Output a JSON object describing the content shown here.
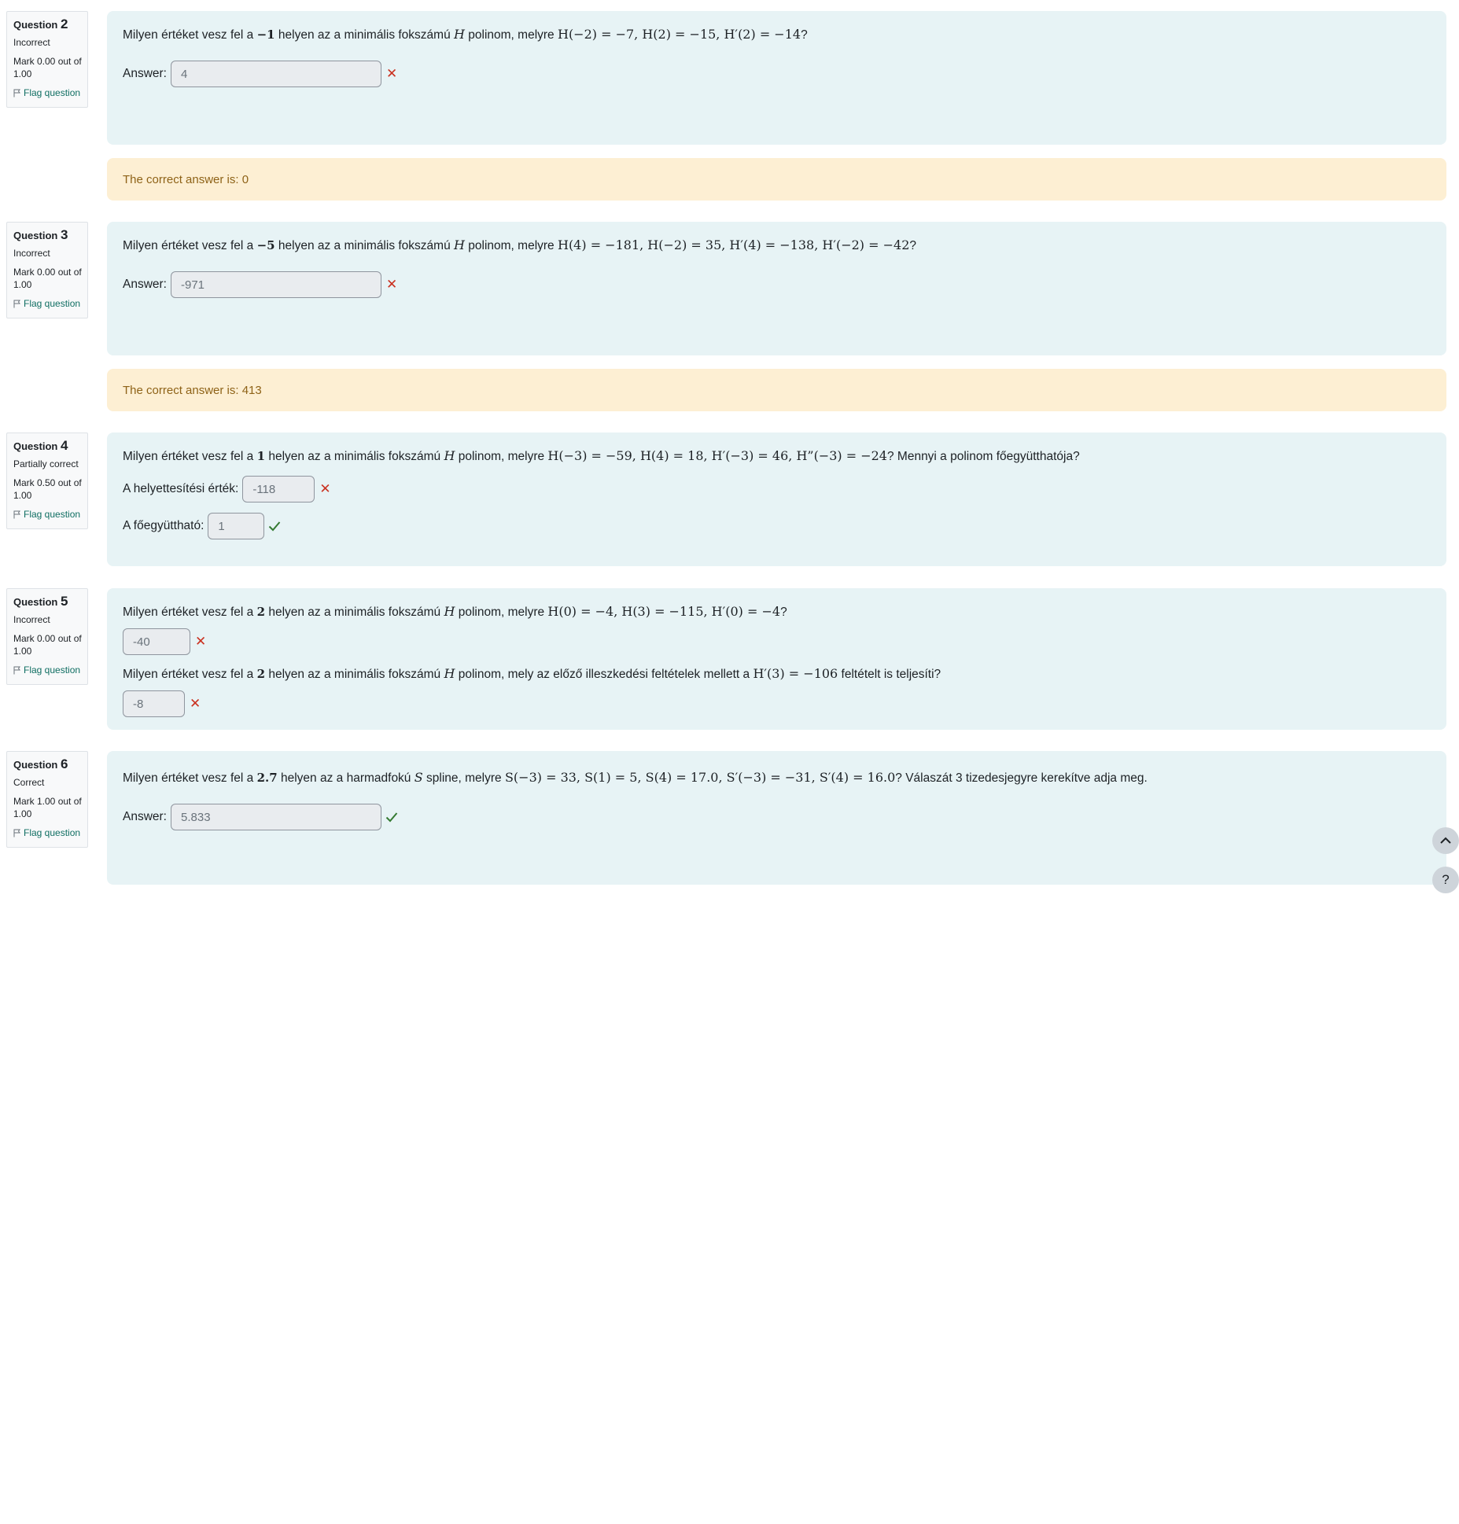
{
  "flag_label": "Flag question",
  "questions": [
    {
      "heading": "Question",
      "number": "2",
      "state": "Incorrect",
      "mark": "Mark 0.00 out of 1.00",
      "text_a": "Milyen értéket vesz fel a ",
      "math_point": "−1",
      "text_b": " helyen az a minimális fokszámú ",
      "math_var": "H",
      "text_c": " polinom, melyre ",
      "conditions": "H(−2) = −7,  H(2) = −15,  H′(2) = −14",
      "text_d": "?",
      "answer_label": "Answer:",
      "answer_value": "4",
      "correct_answer_text": "The correct answer is: 0"
    },
    {
      "heading": "Question",
      "number": "3",
      "state": "Incorrect",
      "mark": "Mark 0.00 out of 1.00",
      "text_a": "Milyen értéket vesz fel a ",
      "math_point": "−5",
      "text_b": " helyen az a minimális fokszámú ",
      "math_var": "H",
      "text_c": " polinom, melyre ",
      "conditions": "H(4) = −181,  H(−2) = 35,  H′(4) = −138, H′(−2) = −42",
      "text_d": "?",
      "answer_label": "Answer:",
      "answer_value": "-971",
      "correct_answer_text": "The correct answer is: 413"
    },
    {
      "heading": "Question",
      "number": "4",
      "state": "Partially correct",
      "mark": "Mark 0.50 out of 1.00",
      "text_a": "Milyen értéket vesz fel a ",
      "math_point": "1",
      "text_b": " helyen az a minimális fokszámú ",
      "math_var": "H",
      "text_c": " polinom, melyre ",
      "conditions": "H(−3) = −59,  H(4) = 18,  H′(−3) = 46, H”(−3) = −24",
      "text_d": "? Mennyi a polinom főegyütthatója?",
      "sub1_label": "A helyettesítési érték:",
      "sub1_value": "-118",
      "sub2_label": "A főegyüttható:",
      "sub2_value": "1"
    },
    {
      "heading": "Question",
      "number": "5",
      "state": "Incorrect",
      "mark": "Mark 0.00 out of 1.00",
      "text_a": "Milyen értéket vesz fel a ",
      "math_point": "2",
      "text_b": " helyen az a minimális fokszámú ",
      "math_var": "H",
      "text_c": " polinom, melyre ",
      "conditions": "H(0) = −4,  H(3) = −115,  H′(0) = −4",
      "text_d": "?",
      "answer1_value": "-40",
      "text2_a": "Milyen értéket vesz fel a ",
      "math2_point": "2",
      "text2_b": " helyen az a minimális fokszámú ",
      "math2_var": "H",
      "text2_c": " polinom, mely az előző illeszkedési feltételek mellett a ",
      "conditions2": "H′(3) = −106",
      "text2_d": " feltételt is teljesíti?",
      "answer2_value": "-8"
    },
    {
      "heading": "Question",
      "number": "6",
      "state": "Correct",
      "mark": "Mark 1.00 out of 1.00",
      "text_a": "Milyen értéket vesz fel a ",
      "math_point": "2.7",
      "text_b": " helyen az a harmadfokú ",
      "math_var": "S",
      "text_c": " spline, melyre ",
      "conditions": "S(−3) = 33,  S(1) = 5,  S(4) = 17.0,  S′(−3) = −31,  S′(4) = 16.0",
      "text_d": "? Válaszát 3 tizedesjegyre kerekítve adja meg.",
      "answer_label": "Answer:",
      "answer_value": "5.833"
    }
  ],
  "scroll_top_icon": "chevron-up-icon",
  "help_label": "?",
  "colors": {
    "content_bg": "#e7f3f5",
    "feedback_bg": "#fdefd3",
    "wrong": "#ca3120",
    "right": "#357a32",
    "link": "#0f6e62"
  }
}
